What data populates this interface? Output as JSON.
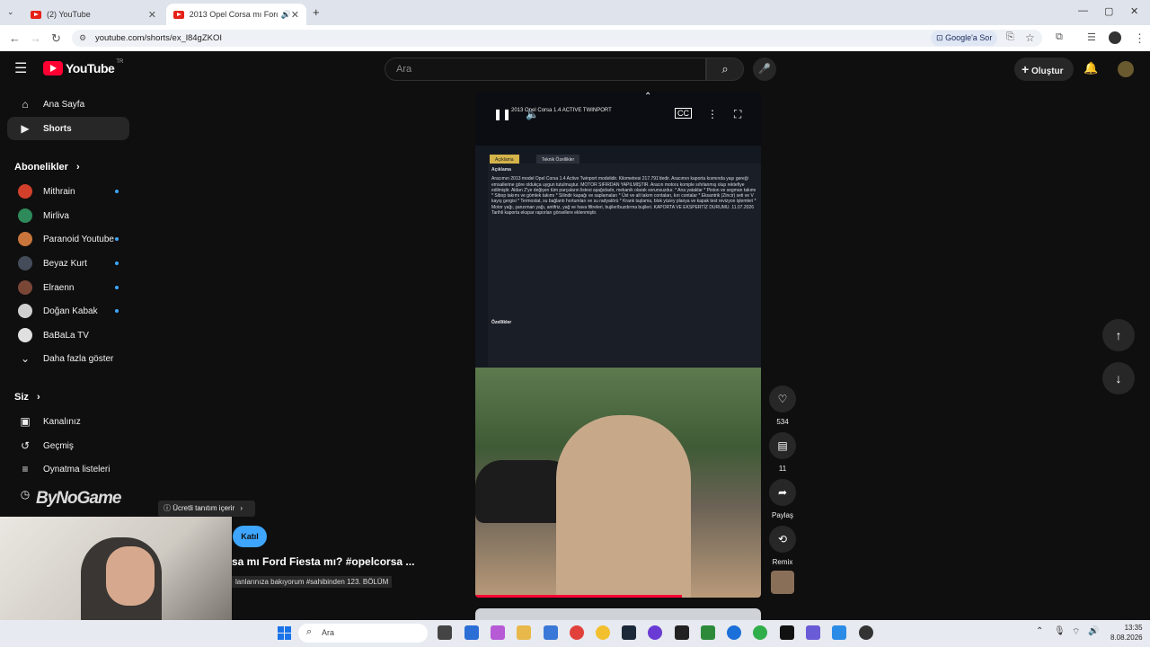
{
  "browser": {
    "tabs": [
      {
        "label": "(2) YouTube"
      },
      {
        "label": "2013 Opel Corsa mı Ford Fi"
      }
    ],
    "url": "youtube.com/shorts/ex_l84gZKOI",
    "google_ask": "Google'a Sor"
  },
  "header": {
    "logo_word": "YouTube",
    "logo_country": "TR",
    "search_placeholder": "Ara",
    "create_label": "Oluştur"
  },
  "sidebar": {
    "main": [
      {
        "label": "Ana Sayfa",
        "icon": "home-icon"
      },
      {
        "label": "Shorts",
        "icon": "shorts-icon"
      }
    ],
    "subs_heading": "Abonelikler",
    "subscriptions": [
      {
        "label": "Mithrain",
        "color": "#d2402b"
      },
      {
        "label": "Mirliva",
        "color": "#2e8a5a"
      },
      {
        "label": "Paranoid Youtube",
        "color": "#c9753c"
      },
      {
        "label": "Beyaz Kurt",
        "color": "#444c5a"
      },
      {
        "label": "Elraenn",
        "color": "#7a4636"
      },
      {
        "label": "Doğan Kabak",
        "color": "#cfcfcf"
      },
      {
        "label": "BaBaLa TV",
        "color": "#e0e0e0"
      }
    ],
    "more_label": "Daha fazla göster",
    "you_heading": "Siz",
    "you_items": [
      {
        "label": "Kanalınız"
      },
      {
        "label": "Geçmiş"
      },
      {
        "label": "Oynatma listeleri"
      }
    ]
  },
  "video": {
    "doc_header": "2013 Opel Corsa 1.4 ACTIVE TWINPORT",
    "doc_tab_active": "Açıklama",
    "doc_tab_other": "Teknik Özellikler",
    "doc_section": "Açıklama",
    "doc_text": "Aracımın 2013 model Opel Corsa 1.4 Active Twinport modelidir. Kilometresi 217.791'dedir. Aracımın kaporta kısmında yaşı gereği emsallerine göre oldukça uygun tutulmuştur. MOTOR SIFIRDAN YAPILMIŞTIR. Aracın motoru komple sıfırlanmış olup rektefiye edilmiştir. Aldan Z'ye değişen tüm parçaların listesi aşağıdadır, mekanik olarak sorunsuzdur. * Ana yataklar * Piston ve segman takımı * Sibop takımı ve gömlek takımı * Silindir kapağı ve saplamaları * Üst ve alt takım contaları, kırı contalar * Eksantrik (Zincir) seti ve V kayış gergisi * Termostat, su bağlantı hortumları ve su radyatörü * Krank taşlama, blok yüzey planya ve kapak test revizyon işlemleri * Motor yağı, şanzıman yağı, antifriz, yağ ve hava filtreleri, bujiler/buzdırma bujileri. KAPORTA VE EKSPERTİZ DURUMU. 11.07.2026 Tarihli kaporta ekspar raporları görsellere eklenmiştir.",
    "doc_features": "Özellikler",
    "paid_tag": "Ücretli tanıtım içerir",
    "join_label": "Katıl",
    "title": "sa mı Ford Fiesta mı? #opelcorsa ...",
    "subtitle": "lanlarınıza bakıyorum #sahibinden 123. BÖLÜM",
    "watermark": "ByNoGame"
  },
  "actions": {
    "likes": "534",
    "comments": "11",
    "share_label": "Paylaş",
    "remix_label": "Remix"
  },
  "taskbar": {
    "search_placeholder": "Ara",
    "time": "13:35",
    "date": "8.08.2026"
  }
}
